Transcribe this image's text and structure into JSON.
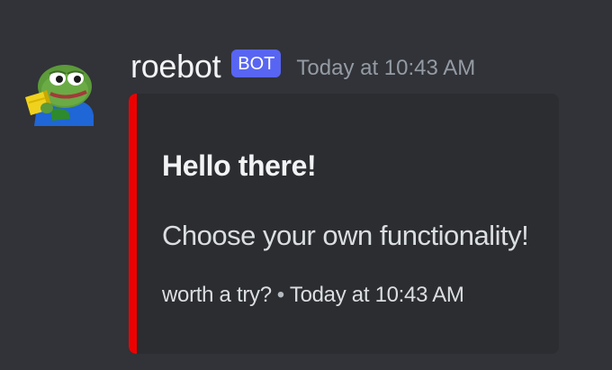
{
  "message": {
    "author": "roebot",
    "bot_tag": "BOT",
    "timestamp": "Today at 10:43 AM",
    "avatar_icon": "pepe-frog-avatar-icon"
  },
  "embed": {
    "accent_color": "#ed0000",
    "title": "Hello there!",
    "description": "Choose your own functionality!",
    "footer_text": "worth a try?",
    "footer_separator": "•",
    "footer_timestamp": "Today at 10:43 AM"
  },
  "colors": {
    "background": "#313338",
    "embed_background": "#2b2d31",
    "bot_tag": "#5865f2",
    "timestamp": "#949ba4"
  }
}
